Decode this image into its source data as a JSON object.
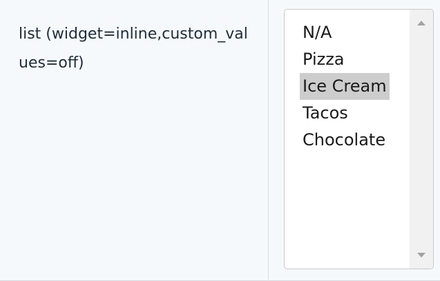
{
  "field": {
    "label": "list (widget=inline,custom_values=off)"
  },
  "listbox": {
    "options": [
      "N/A",
      "Pizza",
      "Ice Cream",
      "Tacos",
      "Chocolate"
    ],
    "selected": "Ice Cream"
  },
  "colors": {
    "selected_background": "#cdcdcd",
    "label_text": "#1e2d3b",
    "panel_background": "#f6f9fc"
  },
  "icons": {
    "scroll_up": "triangle-up-icon",
    "scroll_down": "triangle-down-icon"
  }
}
